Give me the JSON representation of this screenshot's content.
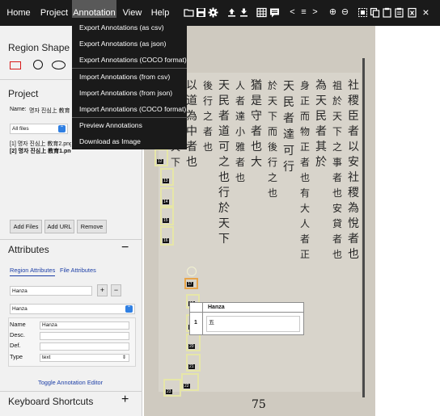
{
  "topbar": {
    "menu": [
      {
        "label": "Home"
      },
      {
        "label": "Project"
      },
      {
        "label": "Annotation"
      },
      {
        "label": "View"
      },
      {
        "label": "Help"
      }
    ],
    "icons": [
      "folder-icon",
      "save-icon",
      "settings-icon",
      "upload-icon",
      "download-icon",
      "grid-icon",
      "chat-icon",
      "prev-icon",
      "list-icon",
      "next-icon",
      "zoom-in-icon",
      "zoom-out-icon",
      "select-region-icon",
      "copy-icon",
      "paste-icon",
      "paste-grid-icon",
      "delete-icon",
      "close-icon"
    ],
    "glyphs": {
      "prev": "<",
      "list": "≡",
      "next": ">",
      "zoom_in": "⊕",
      "zoom_out": "⊖",
      "close": "×"
    }
  },
  "dropdown": {
    "items": [
      {
        "label": "Export Annotations (as csv)"
      },
      {
        "label": "Export Annotations (as json)"
      },
      {
        "label": "Export Annotations (COCO format)"
      },
      {
        "label": "Import Annotations (from csv)"
      },
      {
        "label": "Import Annotations (from json)"
      },
      {
        "label": "Import Annotations (COCO format)"
      },
      {
        "label": "Preview Annotations"
      },
      {
        "label": "Download as Image"
      }
    ]
  },
  "left": {
    "region_shape_title": "Region Shape",
    "project_title": "Project",
    "name_label": "Name:",
    "project_name": "명자 진심上 教育",
    "files_filter": "All files",
    "files": [
      {
        "label": "[1] 명자 진심上 教育2.png"
      },
      {
        "label": "[2] 명자 진심上 教育1.png"
      }
    ],
    "buttons": {
      "add_files": "Add Files",
      "add_url": "Add URL",
      "remove": "Remove"
    },
    "attributes_title": "Attributes",
    "collapse_glyph": "−",
    "tabs": {
      "region": "Region Attributes",
      "file": "File Attributes"
    },
    "attr_input_value": "Hanza",
    "attr_add": "+",
    "attr_remove": "−",
    "attr_select_value": "Hanza",
    "fields": [
      {
        "label": "Name",
        "value": "Hanza"
      },
      {
        "label": "Desc.",
        "value": ""
      },
      {
        "label": "Def.",
        "value": ""
      },
      {
        "label": "Type",
        "value": "text"
      }
    ],
    "toggle_editor": "Toggle Annotation Editor",
    "keyboard_title": "Keyboard Shortcuts",
    "expand_glyph": "+"
  },
  "image": {
    "page_number": "75",
    "text_columns": [
      "社稷臣者以安社稷為悅者也",
      "祖於天下之事者也安貸者也",
      "為天民者其於",
      "身正而物正者也有大人者正",
      "天民者達可行",
      "於天下而後行之也",
      "猶是守者也大",
      "人者達小雅者也",
      "天民者道可之也行於天下",
      "後行之者也",
      "以道為中者也",
      "若不得之天下"
    ],
    "labels": [
      "12",
      "13",
      "14",
      "15",
      "16",
      "17",
      "18",
      "19",
      "20",
      "21",
      "22",
      "23"
    ]
  },
  "annotation_editor": {
    "header": "Hanza",
    "row_index": "1",
    "row_value": "五"
  }
}
